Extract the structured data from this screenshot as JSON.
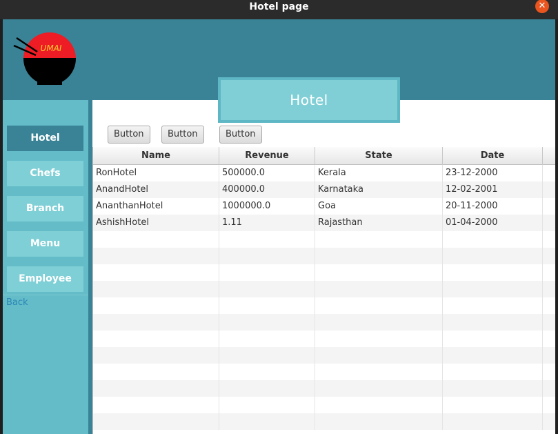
{
  "window": {
    "title": "Hotel page"
  },
  "header": {
    "logo_text": "UMAI"
  },
  "sidebar": {
    "items": [
      {
        "label": "Hotel",
        "active": true
      },
      {
        "label": "Chefs",
        "active": false
      },
      {
        "label": "Branch",
        "active": false
      },
      {
        "label": "Menu",
        "active": false
      },
      {
        "label": "Employee",
        "active": false
      }
    ],
    "back_label": "Back"
  },
  "main": {
    "banner": "Hotel",
    "buttons": [
      "Button",
      "Button",
      "Button"
    ]
  },
  "table": {
    "columns": [
      "Name",
      "Revenue",
      "State",
      "Date"
    ],
    "rows": [
      [
        "RonHotel",
        "500000.0",
        "Kerala",
        "23-12-2000"
      ],
      [
        "AnandHotel",
        "400000.0",
        "Karnataka",
        "12-02-2001"
      ],
      [
        "AnanthanHotel",
        "1000000.0",
        "Goa",
        "20-11-2000"
      ],
      [
        "AshishHotel",
        "1.11",
        "Rajasthan",
        "01-04-2000"
      ]
    ]
  },
  "colors": {
    "accent": "#3a8396",
    "sidebar": "#63bcc8",
    "nav_button": "#7fcfd6",
    "close_button": "#e9541f"
  }
}
